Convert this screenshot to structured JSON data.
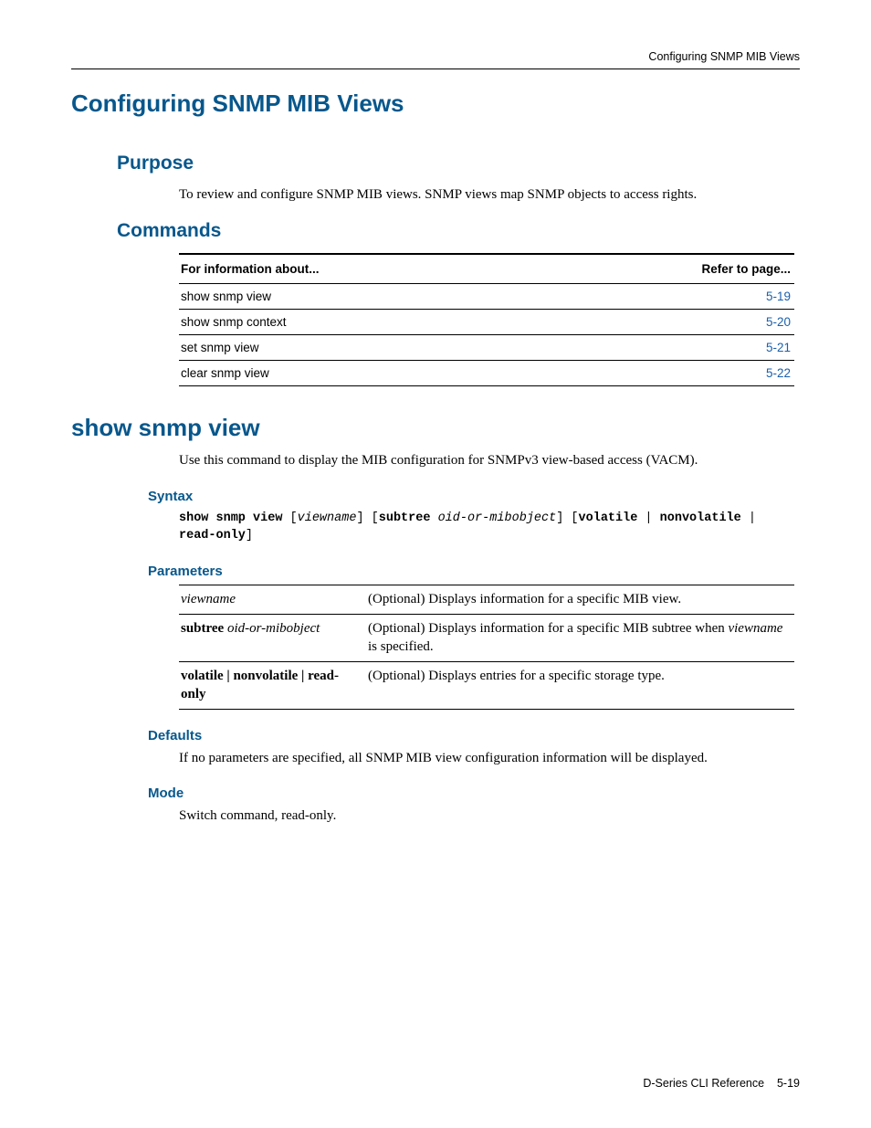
{
  "running_head": "Configuring SNMP MIB Views",
  "h1_main": "Configuring SNMP MIB Views",
  "purpose": {
    "heading": "Purpose",
    "text": "To review and configure SNMP MIB views. SNMP views map SNMP objects to access rights."
  },
  "commands": {
    "heading": "Commands",
    "col1": "For information about...",
    "col2": "Refer to page...",
    "rows": [
      {
        "name": "show snmp view",
        "page": "5-19"
      },
      {
        "name": "show snmp context",
        "page": "5-20"
      },
      {
        "name": "set snmp view",
        "page": "5-21"
      },
      {
        "name": "clear snmp view",
        "page": "5-22"
      }
    ]
  },
  "command_detail": {
    "title": "show snmp view",
    "desc": "Use this command to display the MIB configuration for SNMPv3 view-based access (VACM).",
    "syntax_heading": "Syntax",
    "syntax": {
      "t1": "show snmp view",
      "b1": " [",
      "i1": "viewname",
      "b2": "] [",
      "t2": "subtree",
      "sp1": " ",
      "i2": "oid-or-mibobject",
      "b3": "] [",
      "t3": "volatile",
      "b4": " | ",
      "t4": "nonvolatile",
      "b5": " | ",
      "t5": "read-only",
      "b6": "]"
    },
    "params_heading": "Parameters",
    "params": [
      {
        "key_ital": "viewname",
        "desc_pre": "(Optional) Displays information for a specific MIB view."
      },
      {
        "key_bold": "subtree",
        "key_ital": "oid-or-mibobject",
        "desc_pre": "(Optional) Displays information for a specific MIB subtree when ",
        "desc_ital": "viewname",
        "desc_post": " is specified."
      },
      {
        "key_bold_full": "volatile | nonvolatile | read-only",
        "desc_pre": "(Optional) Displays entries for a specific storage type."
      }
    ],
    "defaults_heading": "Defaults",
    "defaults_text": "If no parameters are specified, all SNMP MIB view configuration information will be displayed.",
    "mode_heading": "Mode",
    "mode_text": "Switch command, read-only."
  },
  "footer": {
    "left": "D-Series CLI Reference",
    "right": "5-19"
  }
}
